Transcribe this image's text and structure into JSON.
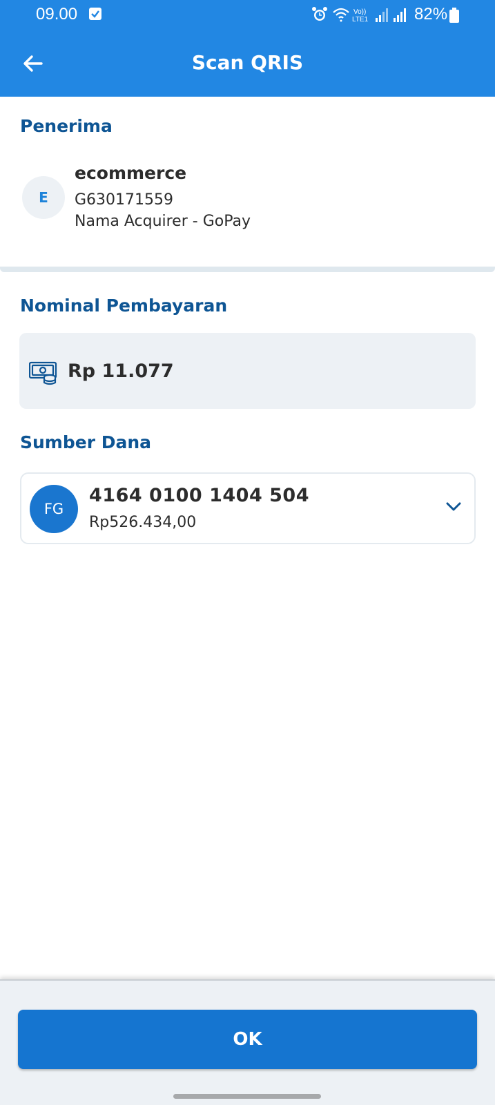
{
  "status_bar": {
    "time": "09.00",
    "network_label": "Vo)) LTE1",
    "battery_percent": "82%"
  },
  "app_bar": {
    "title": "Scan QRIS",
    "back_icon": "arrow-left-icon"
  },
  "recipient": {
    "section_title": "Penerima",
    "avatar_initial": "E",
    "name": "ecommerce",
    "id": "G630171559",
    "acquirer": "Nama Acquirer - GoPay"
  },
  "payment": {
    "section_title": "Nominal Pembayaran",
    "icon": "money-icon",
    "amount": "Rp 11.077"
  },
  "funding_source": {
    "section_title": "Sumber Dana",
    "avatar_initials": "FG",
    "account_number": "4164 0100 1404 504",
    "balance": "Rp526.434,00",
    "icon": "chevron-down-icon"
  },
  "actions": {
    "ok_label": "OK"
  },
  "colors": {
    "primary": "#2287e3",
    "button": "#1575d0",
    "heading": "#0e5594",
    "surface": "#edf1f5"
  }
}
